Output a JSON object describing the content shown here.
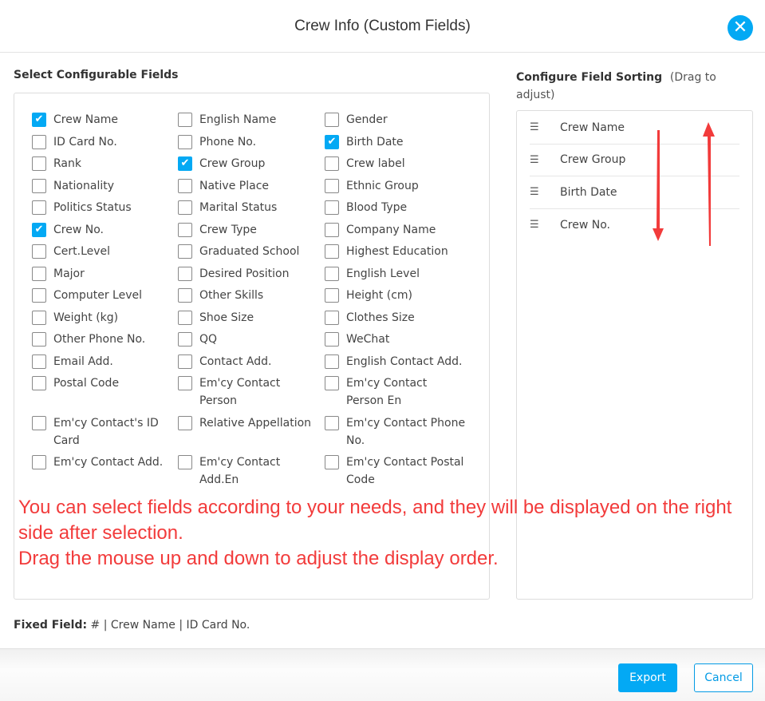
{
  "dialog": {
    "title": "Crew Info (Custom Fields)",
    "close_icon": "close-icon"
  },
  "left": {
    "heading": "Select Configurable Fields",
    "fields": [
      {
        "label": "Crew Name",
        "checked": true
      },
      {
        "label": "English Name",
        "checked": false
      },
      {
        "label": "Gender",
        "checked": false
      },
      {
        "label": "ID Card No.",
        "checked": false
      },
      {
        "label": "Phone No.",
        "checked": false
      },
      {
        "label": "Birth Date",
        "checked": true
      },
      {
        "label": "Rank",
        "checked": false
      },
      {
        "label": "Crew Group",
        "checked": true
      },
      {
        "label": "Crew label",
        "checked": false
      },
      {
        "label": "Nationality",
        "checked": false
      },
      {
        "label": "Native Place",
        "checked": false
      },
      {
        "label": "Ethnic Group",
        "checked": false
      },
      {
        "label": "Politics Status",
        "checked": false
      },
      {
        "label": "Marital Status",
        "checked": false
      },
      {
        "label": "Blood Type",
        "checked": false
      },
      {
        "label": "Crew No.",
        "checked": true
      },
      {
        "label": "Crew Type",
        "checked": false
      },
      {
        "label": "Company Name",
        "checked": false
      },
      {
        "label": "Cert.Level",
        "checked": false
      },
      {
        "label": "Graduated School",
        "checked": false
      },
      {
        "label": "Highest Education",
        "checked": false
      },
      {
        "label": "Major",
        "checked": false
      },
      {
        "label": "Desired Position",
        "checked": false
      },
      {
        "label": "English Level",
        "checked": false
      },
      {
        "label": "Computer Level",
        "checked": false
      },
      {
        "label": "Other Skills",
        "checked": false
      },
      {
        "label": "Height (cm)",
        "checked": false
      },
      {
        "label": "Weight (kg)",
        "checked": false
      },
      {
        "label": "Shoe Size",
        "checked": false
      },
      {
        "label": "Clothes Size",
        "checked": false
      },
      {
        "label": "Other Phone No.",
        "checked": false
      },
      {
        "label": "QQ",
        "checked": false
      },
      {
        "label": "WeChat",
        "checked": false
      },
      {
        "label": "Email Add.",
        "checked": false
      },
      {
        "label": "Contact Add.",
        "checked": false
      },
      {
        "label": "English Contact Add.",
        "checked": false
      },
      {
        "label": "Postal Code",
        "checked": false
      },
      {
        "label": "Em'cy Contact Person",
        "checked": false
      },
      {
        "label": "Em'cy Contact Person En",
        "checked": false
      },
      {
        "label": "Em'cy Contact's ID Card",
        "checked": false
      },
      {
        "label": "Relative Appellation",
        "checked": false
      },
      {
        "label": "Em'cy Contact Phone No.",
        "checked": false
      },
      {
        "label": "Em'cy Contact Add.",
        "checked": false
      },
      {
        "label": "Em'cy Contact Add.En",
        "checked": false
      },
      {
        "label": "Em'cy Contact Postal Code",
        "checked": false
      }
    ]
  },
  "right": {
    "heading": "Configure Field Sorting",
    "subheading": "(Drag to adjust)",
    "items": [
      "Crew Name",
      "Crew Group",
      "Birth Date",
      "Crew No."
    ],
    "drag_icon": "drag-handle-icon"
  },
  "annotation": {
    "line1": "You can select fields according to your needs, and they will be displayed on the right side after selection.",
    "line2": "Drag the mouse up and down to adjust the display order.",
    "color": "#f23b3b"
  },
  "fixed": {
    "label": "Fixed Field:",
    "value": "# | Crew Name | ID Card No."
  },
  "footer": {
    "export": "Export",
    "cancel": "Cancel"
  },
  "colors": {
    "accent": "#03a9f4"
  }
}
